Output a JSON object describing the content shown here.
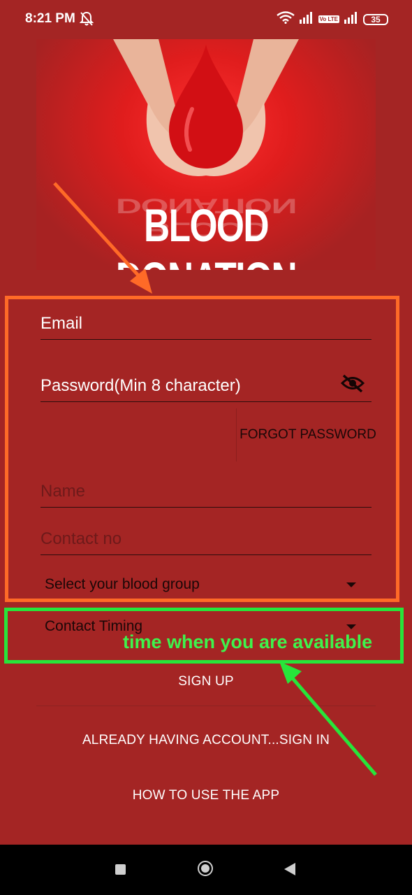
{
  "status_bar": {
    "time": "8:21 PM",
    "volte_label": "Vo LTE",
    "battery": "35",
    "icons": [
      "bell-off-icon",
      "wifi-icon",
      "signal-icon",
      "signal-icon",
      "battery-icon"
    ]
  },
  "banner": {
    "title": "BLOOD DONATION"
  },
  "form": {
    "email_label": "Email",
    "password_label": "Password(Min 8 character)",
    "forgot_password": "FORGOT PASSWORD",
    "name_placeholder": "Name",
    "contact_placeholder": "Contact no",
    "blood_group_selected": "Select your blood group",
    "contact_timing_selected": "Contact Timing"
  },
  "annotation": {
    "green_note": "time when you are available"
  },
  "buttons": {
    "sign_up": "SIGN UP",
    "sign_in": "ALREADY HAVING ACCOUNT...SIGN IN",
    "how_to": "HOW TO USE THE APP"
  },
  "colors": {
    "background": "#a42524",
    "orange_highlight": "#ff6a27",
    "green_highlight": "#27e53a",
    "green_text": "#3ef34c"
  }
}
